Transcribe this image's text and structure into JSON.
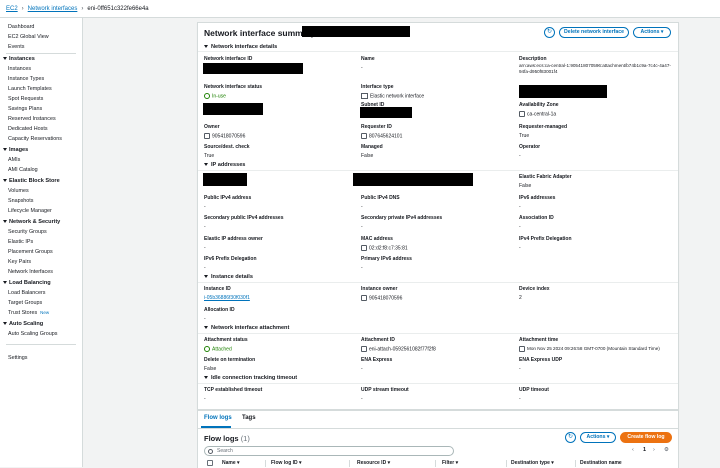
{
  "breadcrumb": [
    "EC2",
    "Network interfaces",
    "eni-0ff651c322fe66e4a"
  ],
  "sidebar": {
    "top_items": [
      "Dashboard",
      "EC2 Global View",
      "Events"
    ],
    "sections": [
      {
        "title": "Instances",
        "items": [
          "Instances",
          "Instance Types",
          "Launch Templates",
          "Spot Requests",
          "Savings Plans",
          "Reserved Instances",
          "Dedicated Hosts",
          "Capacity Reservations"
        ]
      },
      {
        "title": "Images",
        "items": [
          "AMIs",
          "AMI Catalog"
        ]
      },
      {
        "title": "Elastic Block Store",
        "items": [
          "Volumes",
          "Snapshots",
          "Lifecycle Manager"
        ]
      },
      {
        "title": "Network & Security",
        "items": [
          "Security Groups",
          "Elastic IPs",
          "Placement Groups",
          "Key Pairs",
          "Network Interfaces"
        ]
      },
      {
        "title": "Load Balancing",
        "items": [
          "Load Balancers",
          "Target Groups",
          "Trust Stores"
        ]
      },
      {
        "title": "Auto Scaling",
        "items": [
          "Auto Scaling Groups"
        ]
      }
    ],
    "new_badge": "New",
    "settings": "Settings"
  },
  "summary": {
    "title": "Network interface summary for",
    "delete_button": "Delete network interface",
    "actions_button": "Actions",
    "details_header": "Network interface details",
    "ip_header": "IP addresses",
    "instance_header": "Instance details",
    "attachment_header": "Network interface attachment",
    "idle_header": "Idle connection tracking timeout"
  },
  "details": {
    "name_label": "Name",
    "name_value": "-",
    "description_label": "Description",
    "description_value": "arn:aws:ecs:ca-central-1:905418070596:attachment/b74b1c9a-7c4c-4a47-94fa-d950f83001f4",
    "status_label": "Network interface status",
    "status_value": "In-use",
    "type_label": "Interface type",
    "type_value": "Elastic network interface",
    "subnet_label": "Subnet ID",
    "az_label": "Availability Zone",
    "az_value": "ca-central-1a",
    "owner_label": "Owner",
    "owner_value": "905418070596",
    "requester_label": "Requester ID",
    "requester_value": "807645624101",
    "req_managed_label": "Requester-managed",
    "req_managed_value": "True",
    "srcdst_label": "Source/dest. check",
    "srcdst_value": "True",
    "managed_label": "Managed",
    "managed_value": "False",
    "operator_label": "Operator",
    "operator_value": "-"
  },
  "ip": {
    "efa_label": "Elastic Fabric Adapter",
    "efa_value": "False",
    "pub4_label": "Public IPv4 address",
    "pub4_value": "-",
    "pubdns_label": "Public IPv4 DNS",
    "pubdns_value": "-",
    "ipv6_label": "IPv6 addresses",
    "ipv6_value": "-",
    "secpub_label": "Secondary public IPv4 addresses",
    "secpub_value": "-",
    "secpriv_label": "Secondary private IPv4 addresses",
    "secpriv_value": "-",
    "assoc_label": "Association ID",
    "assoc_value": "-",
    "eipowner_label": "Elastic IP address owner",
    "eipowner_value": "-",
    "mac_label": "MAC address",
    "mac_value": "02:d2:f8:c7:35:81",
    "v4prefix_label": "IPv4 Prefix Delegation",
    "v4prefix_value": "-",
    "v6prefix_label": "IPv6 Prefix Delegation",
    "v6prefix_value": "-",
    "primv6_label": "Primary IPv6 address",
    "primv6_value": "-"
  },
  "instance": {
    "id_label": "Instance ID",
    "id_value": "i-05b36886f30f030f1",
    "owner_label": "Instance owner",
    "owner_value": "905418070596",
    "device_label": "Device index",
    "device_value": "2",
    "alloc_label": "Allocation ID",
    "alloc_value": "-"
  },
  "attachment": {
    "status_label": "Attachment status",
    "status_value": "Attached",
    "id_label": "Attachment ID",
    "id_value": "eni-attach-0592561082f77f2f8",
    "time_label": "Attachment time",
    "time_value": "Mon Nov 25 2024 09:26:58 GMT-0700 (Mountain Standard Time)",
    "delete_label": "Delete on termination",
    "delete_value": "False",
    "ena_label": "ENA Express",
    "ena_value": "-",
    "enaudp_label": "ENA Express UDP",
    "enaudp_value": "-"
  },
  "idle": {
    "tcp_label": "TCP established timeout",
    "tcp_value": "-",
    "udp_label": "UDP stream timeout",
    "udp_value": "-",
    "udpt_label": "UDP timeout",
    "udpt_value": "-"
  },
  "bottom": {
    "tabs": [
      "Flow logs",
      "Tags"
    ],
    "flow_title": "Flow logs",
    "flow_count": "(1)",
    "actions_button": "Actions",
    "create_button": "Create flow log",
    "search_placeholder": "Search",
    "page": "1",
    "columns": [
      "Name",
      "Flow log ID",
      "Resource ID",
      "Filter",
      "Destination type",
      "Destination name"
    ]
  }
}
